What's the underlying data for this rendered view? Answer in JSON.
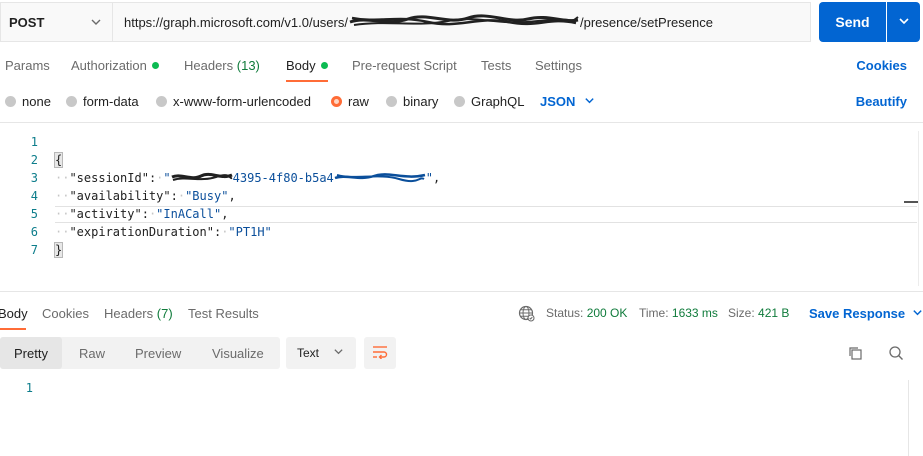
{
  "request": {
    "method": "POST",
    "url_prefix": "https://graph.microsoft.com/v1.0/users/",
    "url_suffix": "/presence/setPresence",
    "send_label": "Send"
  },
  "request_tabs": {
    "params": "Params",
    "authorization": "Authorization",
    "headers": "Headers",
    "headers_count": "(13)",
    "body": "Body",
    "pre_request": "Pre-request Script",
    "tests": "Tests",
    "settings": "Settings",
    "cookies_link": "Cookies"
  },
  "body_types": {
    "none": "none",
    "form_data": "form-data",
    "urlencoded": "x-www-form-urlencoded",
    "raw": "raw",
    "binary": "binary",
    "graphql": "GraphQL",
    "language": "JSON",
    "beautify": "Beautify",
    "selected": "raw"
  },
  "editor": {
    "line_numbers": [
      "1",
      "2",
      "3",
      "4",
      "5",
      "6",
      "7"
    ],
    "open_brace": "{",
    "close_brace": "}",
    "session_key": "\"sessionId\"",
    "session_value_visible": "4395-4f80-b5a4",
    "availability_key": "\"availability\"",
    "availability_value": "\"Busy\"",
    "activity_key": "\"activity\"",
    "activity_value": "\"InACall\"",
    "expiration_key": "\"expirationDuration\"",
    "expiration_value": "\"PT1H\""
  },
  "response_tabs": {
    "body": "Body",
    "cookies": "Cookies",
    "headers": "Headers",
    "headers_count": "(7)",
    "test_results": "Test Results"
  },
  "response_meta": {
    "status_label": "Status:",
    "status_value": "200 OK",
    "time_label": "Time:",
    "time_value": "1633 ms",
    "size_label": "Size:",
    "size_value": "421 B",
    "save_response": "Save Response"
  },
  "response_toolbar": {
    "pretty": "Pretty",
    "raw": "Raw",
    "preview": "Preview",
    "visualize": "Visualize",
    "format": "Text"
  },
  "response_editor": {
    "line_numbers": [
      "1"
    ]
  },
  "colors": {
    "accent": "#ff6c37",
    "primary": "#0265d2",
    "success": "#0f7b3b"
  }
}
